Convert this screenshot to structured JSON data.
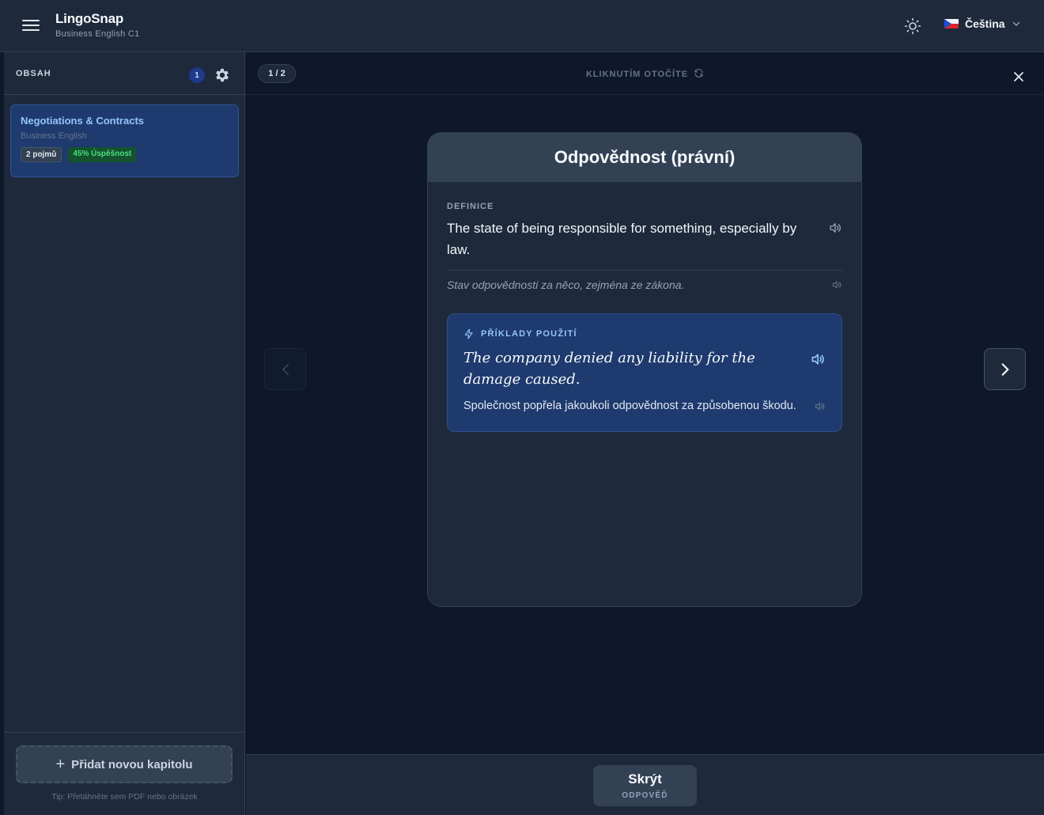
{
  "app": {
    "name": "LingoSnap",
    "subtitle": "Business English C1"
  },
  "header": {
    "language_label": "Čeština"
  },
  "sidebar": {
    "title": "OBSAH",
    "count": "1",
    "chapters": [
      {
        "title": "Negotiations & Contracts",
        "subtitle": "Business English",
        "terms_tag": "2 pojmů",
        "success_tag": "45% Úspěšnost"
      }
    ],
    "add_button_label": "Přidat novou kapitolu",
    "tip": "Tip: Přetáhněte sem PDF nebo obrázek"
  },
  "study": {
    "progress": "1 / 2",
    "flip_hint": "KLIKNUTÍM OTOČÍTE",
    "card": {
      "term": "Odpovědnost (právní)",
      "definition_label": "DEFINICE",
      "definition": "The state of being responsible for something, especially by law.",
      "definition_translation": "Stav odpovědnosti za něco, zejména ze zákona.",
      "examples_label": "PŘÍKLADY POUŽITÍ",
      "example": "The company denied any liability for the damage caused.",
      "example_translation": "Společnost popřela jakoukoli odpovědnost za způsobenou škodu."
    },
    "hide_button": {
      "label": "Skrýt",
      "sublabel": "ODPOVĚĎ"
    }
  },
  "colors": {
    "background": "#0f172a",
    "panel": "#1e293b",
    "accent": "#93c5fd",
    "success": "#4ade80"
  },
  "icons": [
    "menu-icon",
    "sun-icon",
    "flag-cz-icon",
    "chevron-down-icon",
    "gear-icon",
    "close-icon",
    "refresh-icon",
    "chevron-left-icon",
    "chevron-right-icon",
    "speaker-icon",
    "sparkle-icon",
    "plus-icon"
  ]
}
